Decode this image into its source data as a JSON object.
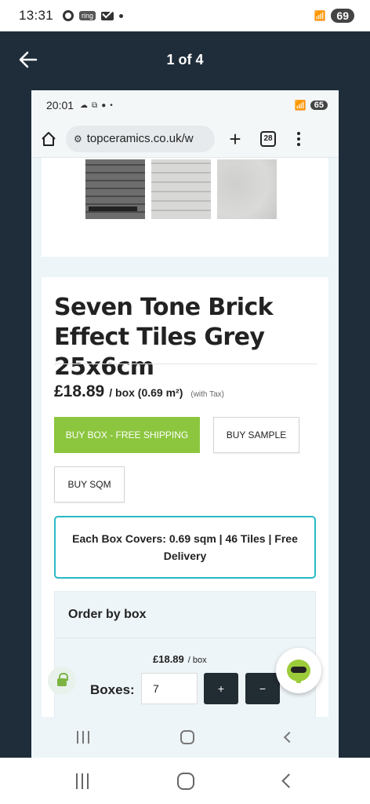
{
  "outer_status": {
    "time": "13:31",
    "ring_label": "ring",
    "battery": "69"
  },
  "viewer": {
    "page_counter": "1 of 4"
  },
  "inner_status": {
    "time": "20:01",
    "battery": "65"
  },
  "browser": {
    "url": "topceramics.co.uk/w",
    "tab_count": "28"
  },
  "product": {
    "title": "Seven Tone Brick Effect Tiles Grey 25x6cm",
    "price": "£18.89",
    "price_unit": "/ box (0.69 m²)",
    "tax_note": "(with Tax)",
    "buy_box_label": "BUY BOX - FREE SHIPPING",
    "buy_sample_label": "BUY SAMPLE",
    "buy_sqm_label": "BUY SQM",
    "covers_text": "Each Box Covers: 0.69 sqm | 46 Tiles | Free Delivery"
  },
  "order": {
    "title": "Order by box",
    "price": "£18.89",
    "price_unit": "/ box",
    "boxes_label": "Boxes:",
    "quantity": "7",
    "plus_label": "+",
    "minus_label": "−"
  },
  "colors": {
    "viewer_bg": "#1f2d3a",
    "buy_green": "#8cc63f",
    "covers_border": "#29b9c4"
  }
}
